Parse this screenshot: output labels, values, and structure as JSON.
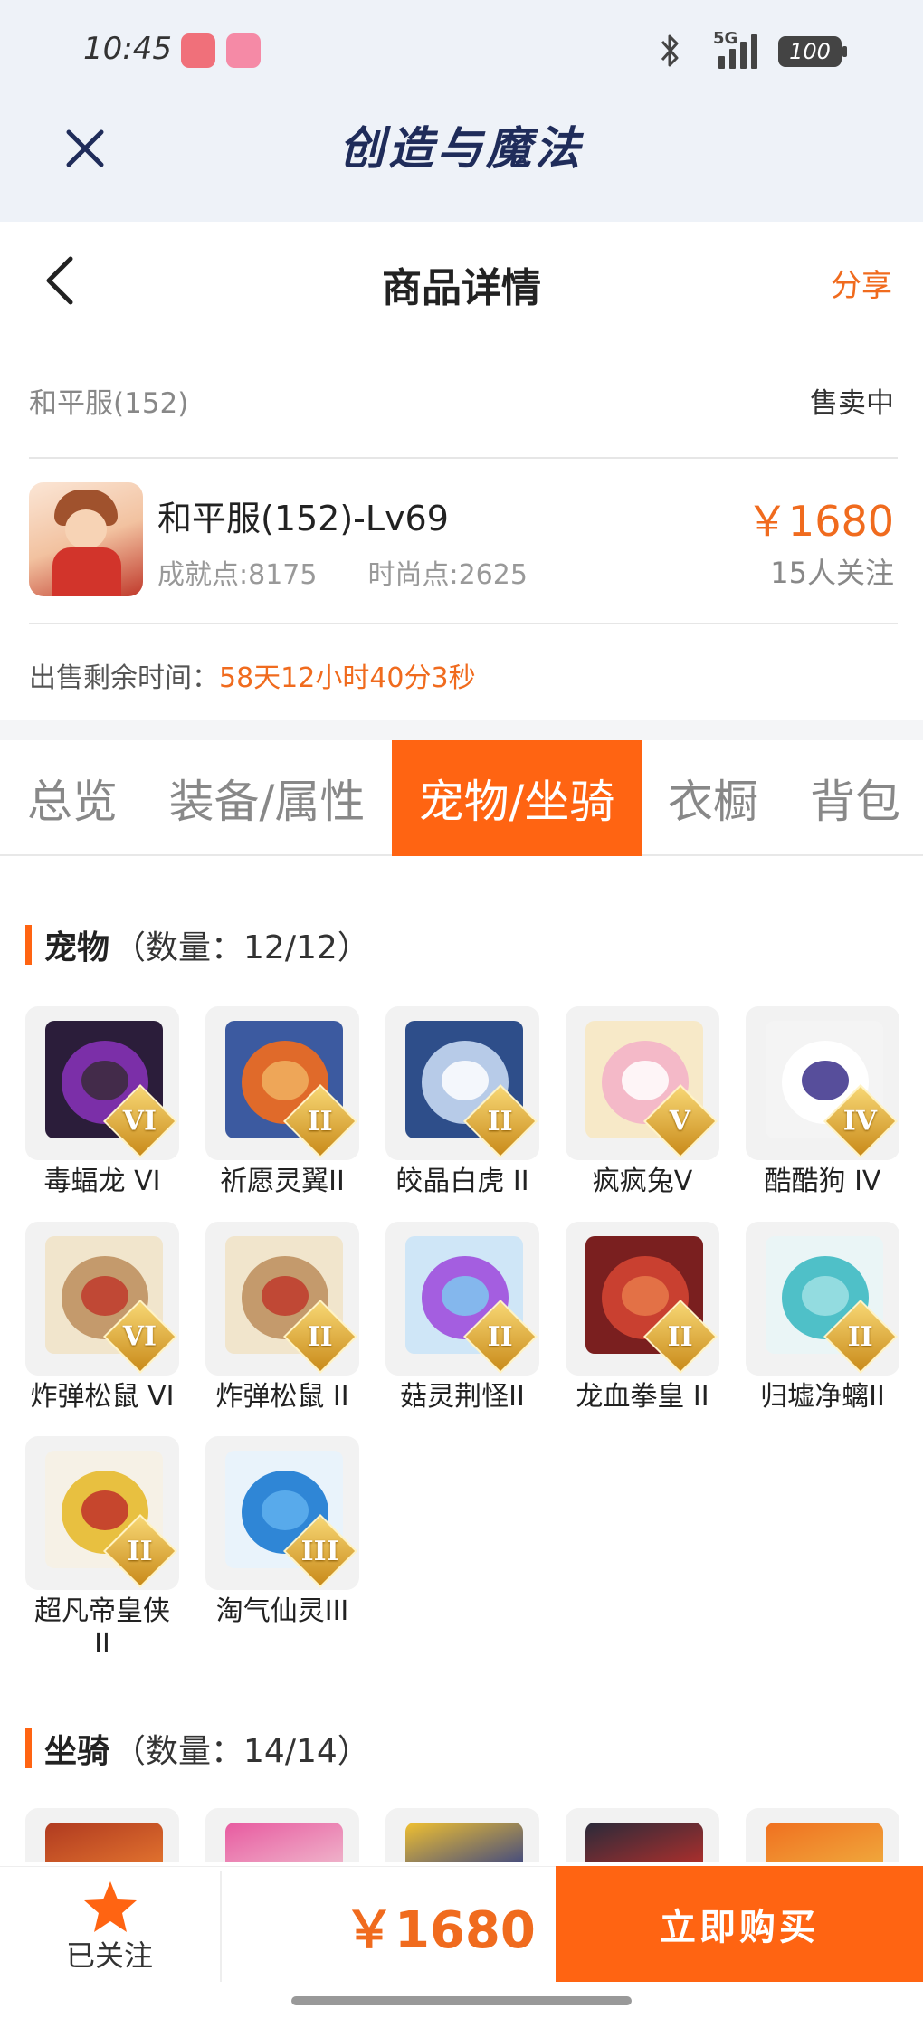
{
  "status_bar": {
    "time": "10:45",
    "network": "5G",
    "battery": "100",
    "app_icons": [
      "notification-app-1",
      "bilibili-app"
    ]
  },
  "app_bar": {
    "title": "创造与魔法"
  },
  "header": {
    "title": "商品详情",
    "share": "分享"
  },
  "listing": {
    "server": "和平服(152)",
    "status": "售卖中",
    "name": "和平服(152)-Lv69",
    "achievement": "成就点:8175",
    "fashion": "时尚点:2625",
    "price": "￥1680",
    "followers": "15人关注",
    "time_left_label": "出售剩余时间：",
    "time_left_value": "58天12小时40分3秒"
  },
  "tabs": [
    {
      "label": "总览",
      "active": false
    },
    {
      "label": "装备/属性",
      "active": false
    },
    {
      "label": "宠物/坐骑",
      "active": true
    },
    {
      "label": "衣橱",
      "active": false
    },
    {
      "label": "背包",
      "active": false
    }
  ],
  "pets_section": {
    "title": "宠物",
    "count": "（数量：12/12）"
  },
  "pets": [
    {
      "name": "毒蝠龙 VI",
      "badge": "VI",
      "colors": [
        "#2b1d3a",
        "#7b2fa8",
        "#3a2a3a"
      ]
    },
    {
      "name": "祈愿灵翼II",
      "badge": "II",
      "colors": [
        "#3c5aa0",
        "#e06a2a",
        "#f0b060"
      ]
    },
    {
      "name": "皎晶白虎 II",
      "badge": "II",
      "colors": [
        "#2e4e8a",
        "#b7cbe8",
        "#ffffff"
      ]
    },
    {
      "name": "疯疯兔V",
      "badge": "V",
      "colors": [
        "#f7e9c8",
        "#f4b9c8",
        "#ffffff"
      ]
    },
    {
      "name": "酷酷狗 IV",
      "badge": "IV",
      "colors": [
        "#f4f4f4",
        "#ffffff",
        "#3a2f8a"
      ]
    },
    {
      "name": "炸弹松鼠 VI",
      "badge": "VI",
      "colors": [
        "#f1e5cc",
        "#c49a6c",
        "#c0392b"
      ]
    },
    {
      "name": "炸弹松鼠 II",
      "badge": "II",
      "colors": [
        "#f1e5cc",
        "#c49a6c",
        "#c0392b"
      ]
    },
    {
      "name": "菇灵荆怪II",
      "badge": "II",
      "colors": [
        "#cfe6f7",
        "#a45ee0",
        "#7fc7ef"
      ]
    },
    {
      "name": "龙血拳皇 II",
      "badge": "II",
      "colors": [
        "#7a1f1f",
        "#c94030",
        "#e87a4a"
      ]
    },
    {
      "name": "归墟净螭II",
      "badge": "II",
      "colors": [
        "#eaf5f6",
        "#4fc0c8",
        "#9fe0e4"
      ]
    },
    {
      "name": "超凡帝皇侠 II",
      "badge": "II",
      "colors": [
        "#f6f1e6",
        "#e8c040",
        "#c0302a"
      ]
    },
    {
      "name": "淘气仙灵III",
      "badge": "III",
      "colors": [
        "#e9f3fb",
        "#2f86d6",
        "#5fb0ef"
      ]
    }
  ],
  "mounts_section": {
    "title": "坐骑",
    "count": "（数量：14/14）"
  },
  "mount_peeks": [
    {
      "colors": [
        "#b03a20",
        "#e87a30"
      ]
    },
    {
      "colors": [
        "#e85aa0",
        "#f0c0d0"
      ]
    },
    {
      "colors": [
        "#f0c030",
        "#2a3a8a"
      ]
    },
    {
      "colors": [
        "#2a2a3a",
        "#c0302a"
      ]
    },
    {
      "colors": [
        "#f07020",
        "#f0b040"
      ]
    }
  ],
  "bottom_bar": {
    "follow_label": "已关注",
    "price": "￥1680",
    "buy_label": "立即购买"
  },
  "colors": {
    "accent": "#ff6412",
    "price": "#f06b1e",
    "title": "#1f2c5a"
  }
}
